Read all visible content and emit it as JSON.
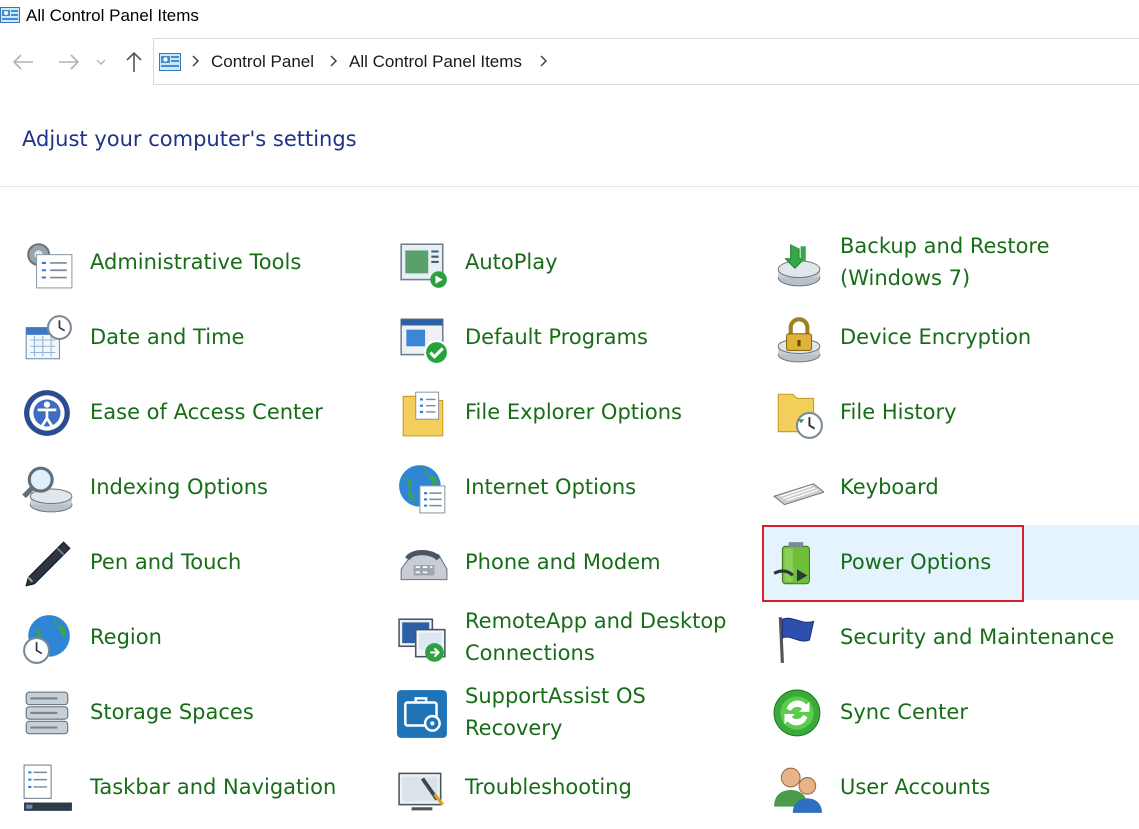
{
  "window": {
    "title": "All Control Panel Items"
  },
  "breadcrumb": [
    "Control Panel",
    "All Control Panel Items"
  ],
  "heading": "Adjust your computer's settings",
  "colors": {
    "link": "#176d17",
    "heading": "#1e3287",
    "hover": "#e5f3ff",
    "highlight": "#d6202b"
  },
  "items": [
    {
      "label": "Administrative Tools",
      "icon": "admin-tools-icon"
    },
    {
      "label": "AutoPlay",
      "icon": "autoplay-icon"
    },
    {
      "label": "Backup and Restore\n(Windows 7)",
      "icon": "backup-restore-icon"
    },
    {
      "label": "Date and Time",
      "icon": "date-time-icon"
    },
    {
      "label": "Default Programs",
      "icon": "default-programs-icon"
    },
    {
      "label": "Device Encryption",
      "icon": "device-encryption-icon"
    },
    {
      "label": "Ease of Access Center",
      "icon": "ease-of-access-icon"
    },
    {
      "label": "File Explorer Options",
      "icon": "file-explorer-options-icon"
    },
    {
      "label": "File History",
      "icon": "file-history-icon"
    },
    {
      "label": "Indexing Options",
      "icon": "indexing-options-icon"
    },
    {
      "label": "Internet Options",
      "icon": "internet-options-icon"
    },
    {
      "label": "Keyboard",
      "icon": "keyboard-icon"
    },
    {
      "label": "Pen and Touch",
      "icon": "pen-touch-icon"
    },
    {
      "label": "Phone and Modem",
      "icon": "phone-modem-icon"
    },
    {
      "label": "Power Options",
      "icon": "power-options-icon"
    },
    {
      "label": "Region",
      "icon": "region-icon"
    },
    {
      "label": "RemoteApp and Desktop\nConnections",
      "icon": "remoteapp-icon"
    },
    {
      "label": "Security and Maintenance",
      "icon": "security-maintenance-icon"
    },
    {
      "label": "Storage Spaces",
      "icon": "storage-spaces-icon"
    },
    {
      "label": "SupportAssist OS\nRecovery",
      "icon": "supportassist-icon"
    },
    {
      "label": "Sync Center",
      "icon": "sync-center-icon"
    },
    {
      "label": "Taskbar and Navigation",
      "icon": "taskbar-navigation-icon"
    },
    {
      "label": "Troubleshooting",
      "icon": "troubleshooting-icon"
    },
    {
      "label": "User Accounts",
      "icon": "user-accounts-icon"
    }
  ],
  "hovered_item": "Power Options"
}
